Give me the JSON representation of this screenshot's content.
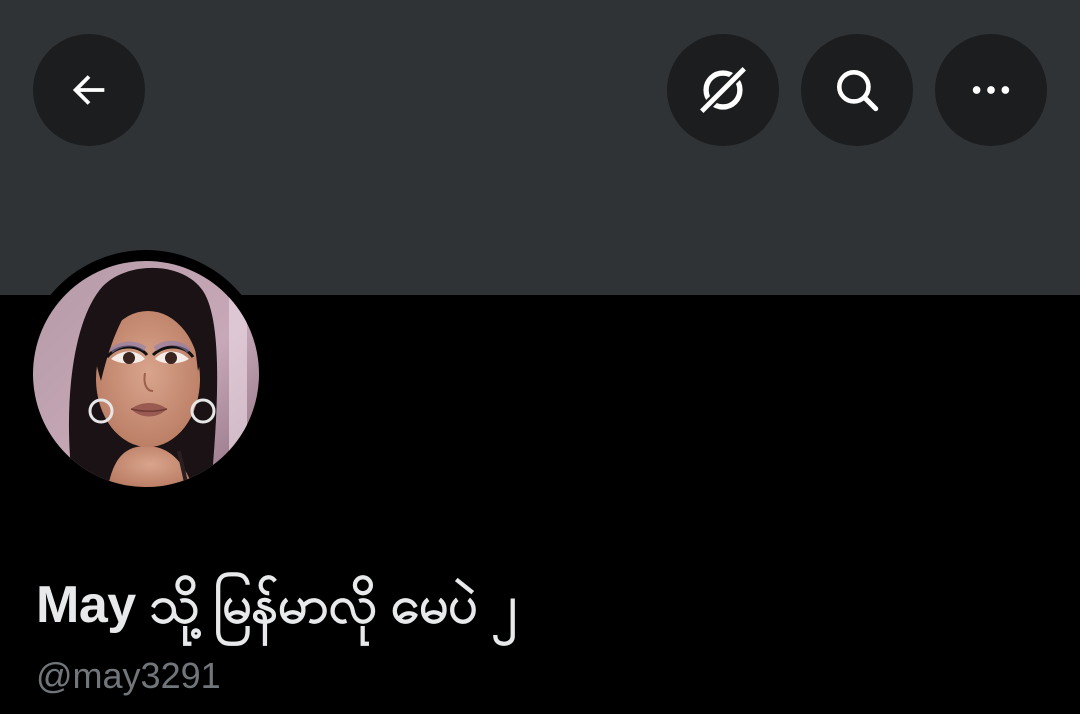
{
  "header": {
    "back_icon": "arrow-left-icon",
    "grok_icon": "grok-icon",
    "search_icon": "search-icon",
    "more_icon": "more-horizontal-icon"
  },
  "profile": {
    "display_name": "May သို့ မြန်မာလို မေပဲ ၂",
    "handle": "@may3291"
  },
  "colors": {
    "banner": "#2f3336",
    "background": "#000000",
    "button_bg": "#1b1d1f",
    "name": "#e7e9ea",
    "handle": "#71767b"
  }
}
